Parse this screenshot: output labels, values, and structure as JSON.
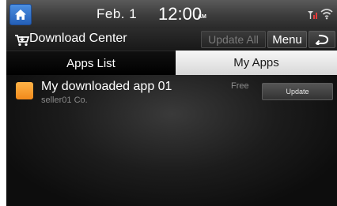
{
  "status_bar": {
    "date": "Feb.  1",
    "time": "12:00",
    "ampm": "AM",
    "icons": [
      "home-icon",
      "signal-icon",
      "wifi-icon"
    ]
  },
  "title_bar": {
    "title": "Download Center",
    "icon": "cart-icon",
    "update_all_label": "Update All",
    "menu_label": "Menu",
    "back_icon": "back-arrow-icon"
  },
  "tabs": [
    {
      "label": "Apps List",
      "selected": false
    },
    {
      "label": "My Apps",
      "selected": true
    }
  ],
  "apps": [
    {
      "name": "My downloaded app 01",
      "seller": "seller01 Co.",
      "price": "Free",
      "action_label": "Update",
      "icon_color": "#f7a030"
    }
  ],
  "colors": {
    "home_button": "#2f6fca",
    "selected_tab": "#e6e6e6",
    "background": "#0c0c0c"
  }
}
